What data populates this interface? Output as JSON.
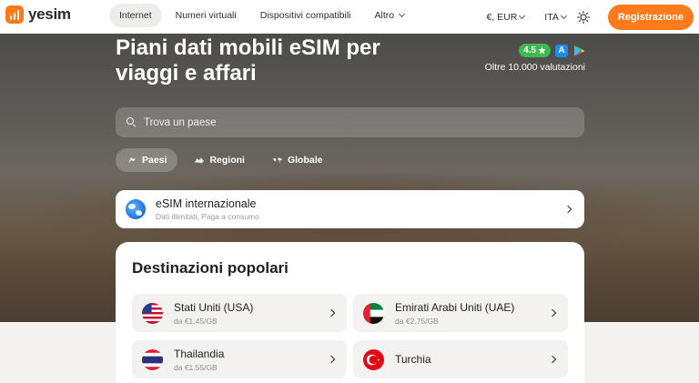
{
  "header": {
    "logo_text": "yesim",
    "nav": [
      {
        "label": "Internet",
        "active": true
      },
      {
        "label": "Numeri virtuali"
      },
      {
        "label": "Dispositivi compatibili"
      },
      {
        "label": "Altro"
      }
    ],
    "currency": "€, EUR",
    "language": "ITA",
    "register_label": "Registrazione"
  },
  "hero": {
    "title": "Piani dati mobili eSIM per viaggi e affari",
    "rating": "4.5",
    "reviews": "Oltre 10.000 valutazioni",
    "search_placeholder": "Trova un paese",
    "tabs": [
      {
        "label": "Paesi",
        "active": true
      },
      {
        "label": "Regioni"
      },
      {
        "label": "Globale"
      }
    ],
    "international": {
      "title": "eSIM internazionale",
      "subtitle": "Dati illimitati, Paga a consumo"
    }
  },
  "popular": {
    "title": "Destinazioni popolari",
    "destinations": [
      {
        "name": "Stati Uniti (USA)",
        "price": "da €1.45/GB"
      },
      {
        "name": "Emirati Arabi Uniti (UAE)",
        "price": "da €2.75/GB"
      },
      {
        "name": "Thailandia",
        "price": "da €1.55/GB"
      },
      {
        "name": "Turchia",
        "price": ""
      }
    ]
  },
  "colors": {
    "accent": "#ff7a1a",
    "rating_green": "#3fb950"
  }
}
